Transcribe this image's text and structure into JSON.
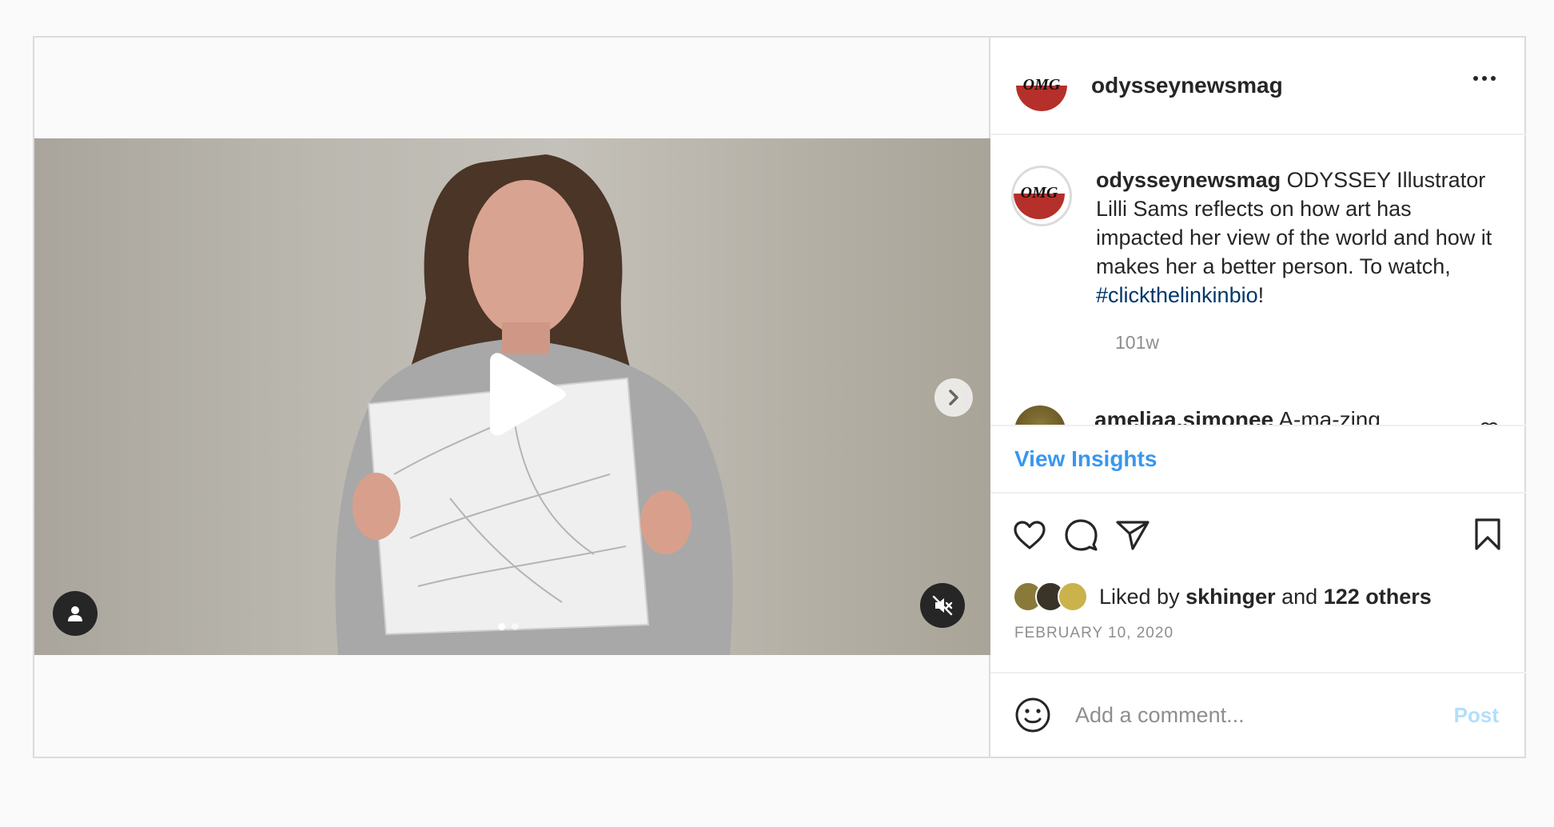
{
  "post": {
    "author": {
      "username": "odysseynewsmag",
      "avatar_text": "OMG"
    },
    "caption": {
      "username": "odysseynewsmag",
      "text": " ODYSSEY Illustrator Lilli Sams reflects on how art has impacted her view of the world and how it makes her a better person. To watch, ",
      "hashtag": "#clickthelinkinbio",
      "suffix": "!",
      "time": "101w"
    },
    "comment": {
      "username": "ameliaa.simonee",
      "text": " A-ma-zing"
    },
    "insights_label": "View Insights",
    "likes": {
      "prefix": "Liked by ",
      "user": "skhinger",
      "middle": " and ",
      "others": "122 others"
    },
    "date": "FEBRUARY 10, 2020",
    "comment_box": {
      "placeholder": "Add a comment...",
      "post_label": "Post"
    },
    "media": {
      "carousel_count": 2,
      "carousel_active": 1
    },
    "colors": {
      "link": "#3897f0",
      "hashtag": "#00376b",
      "post_disabled": "#b2dffc",
      "brand_red": "#b5302a"
    }
  }
}
